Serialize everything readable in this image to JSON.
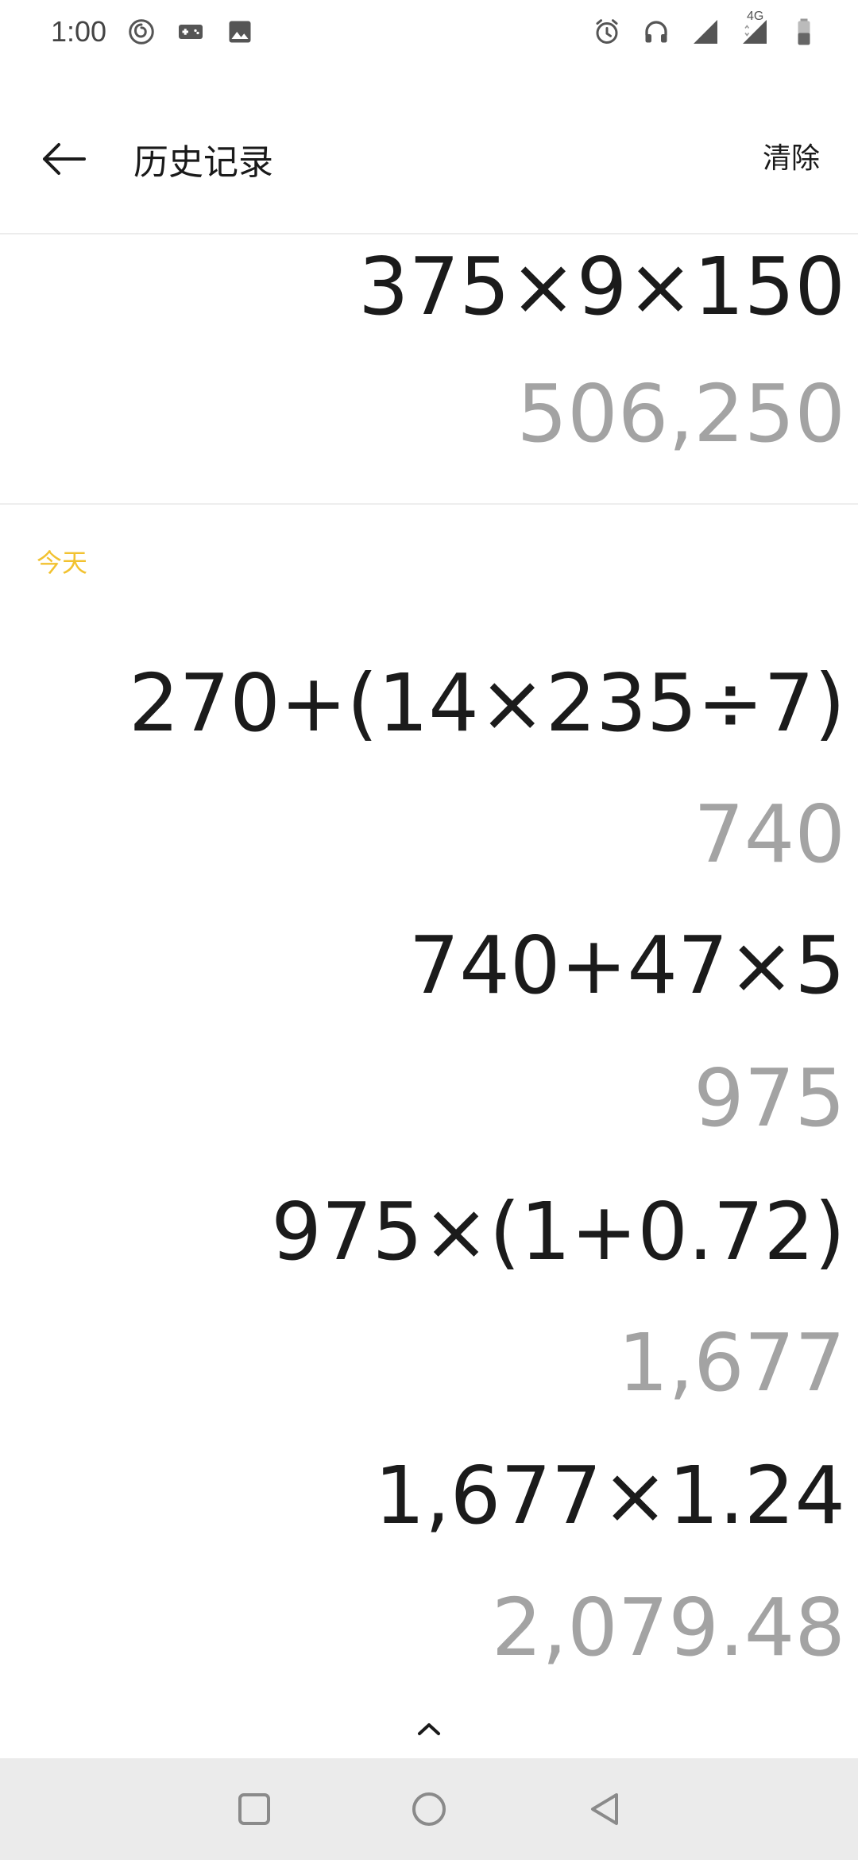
{
  "status_bar": {
    "time": "1:00",
    "left_icons": [
      "netease-music-icon",
      "gamepad-icon",
      "image-icon"
    ],
    "right_icons": [
      "alarm-icon",
      "headphones-icon",
      "signal-icon",
      "signal-4g-icon",
      "battery-icon"
    ],
    "network_label": "4G"
  },
  "app_bar": {
    "title": "历史记录",
    "clear_label": "清除"
  },
  "history": {
    "top_entry": {
      "expression": "375×9×150",
      "result": "506,250"
    },
    "section_label": "今天",
    "today_entries": [
      {
        "expression": "270+(14×235÷7)",
        "result": "740"
      },
      {
        "expression": "740+47×5",
        "result": "975"
      },
      {
        "expression": "975×(1+0.72)",
        "result": "1,677"
      },
      {
        "expression": "1,677×1.24",
        "result": "2,079.48"
      }
    ]
  },
  "colors": {
    "section_label": "#f2c230",
    "expression": "#1b1b1b",
    "result": "#a3a3a3",
    "nav_bar": "#ebebeb"
  }
}
